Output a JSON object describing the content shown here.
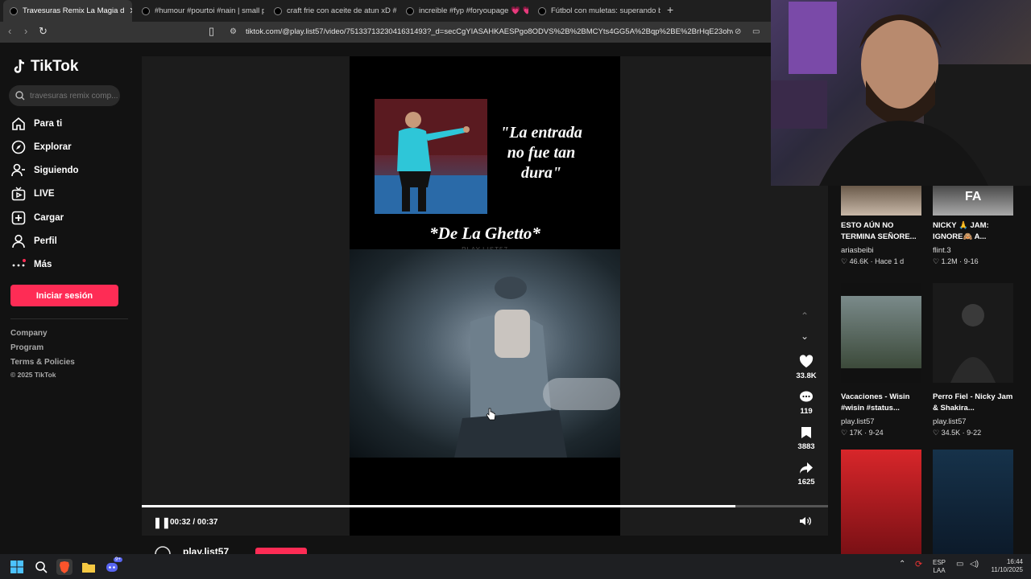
{
  "browser": {
    "tabs": [
      {
        "label": "Travesuras Remix La Magia d",
        "active": true
      },
      {
        "label": "#humour #pourtoi #nain | small peo"
      },
      {
        "label": "craft frie con aceite de atun xD #vide"
      },
      {
        "label": "increible #fyp #foryoupage 💗 💗 #fy"
      },
      {
        "label": "Fútbol con muletas: superando barre"
      }
    ],
    "url": "tiktok.com/@play.list57/video/7513371323041631493?_d=secCgYIASAHKAESPgo8ODVS%2B%2BMCYts4GG5A%2Bqp%2BE%2BrHqE23ohvn6Uu..."
  },
  "sidebar": {
    "logo": "TikTok",
    "search_placeholder": "travesuras remix comp...",
    "nav": [
      {
        "label": "Para ti",
        "icon": "home-icon"
      },
      {
        "label": "Explorar",
        "icon": "compass-icon"
      },
      {
        "label": "Siguiendo",
        "icon": "following-icon"
      },
      {
        "label": "LIVE",
        "icon": "live-icon"
      },
      {
        "label": "Cargar",
        "icon": "upload-icon"
      },
      {
        "label": "Perfil",
        "icon": "profile-icon"
      },
      {
        "label": "Más",
        "icon": "more-icon"
      }
    ],
    "login": "Iniciar sesión",
    "footer": [
      "Company",
      "Program",
      "Terms & Policies"
    ],
    "copyright": "© 2025 TikTok"
  },
  "video": {
    "quote": "\"La entrada no fue tan dura\"",
    "caption": "*De La Ghetto*",
    "watermark": "PLAY.LIST57",
    "time": "00:32 / 00:37",
    "progress": 0.865,
    "likes": "33.8K",
    "comments": "119",
    "saves": "3883",
    "shares": "1625",
    "username": "play.list57"
  },
  "related": [
    {
      "title": "ESTO AÚN NO TERMINA SEÑORE...",
      "user": "ariasbeibi",
      "meta": "♡ 46.6K · Hace 1 d"
    },
    {
      "title": "NICKY 🙏 JAM: IGNORE🙈 A...",
      "user": "flint.3",
      "meta": "♡ 1.2M · 9-16"
    },
    {
      "title": "Vacaciones - Wisin #wisin #status...",
      "user": "play.list57",
      "meta": "♡ 17K · 9-24"
    },
    {
      "title": "Perro Fiel - Nicky Jam & Shakira...",
      "user": "play.list57",
      "meta": "♡ 34.5K · 9-22"
    }
  ],
  "taskbar": {
    "lang": "ESP",
    "lang2": "LAA",
    "time": "16:44",
    "date": "11/10/2025",
    "badge": "9+"
  }
}
